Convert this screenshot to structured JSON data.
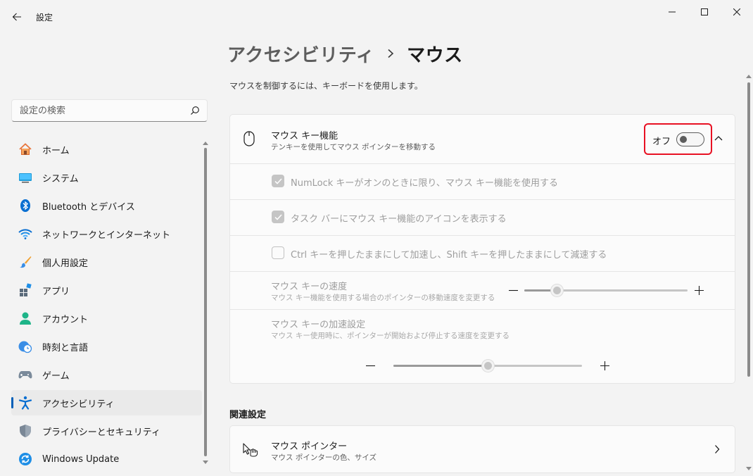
{
  "window": {
    "title": "設定"
  },
  "search": {
    "placeholder": "設定の検索"
  },
  "nav": {
    "items": [
      {
        "label": "ホーム",
        "icon": "home-icon"
      },
      {
        "label": "システム",
        "icon": "monitor-icon"
      },
      {
        "label": "Bluetooth とデバイス",
        "icon": "bluetooth-icon"
      },
      {
        "label": "ネットワークとインターネット",
        "icon": "wifi-icon"
      },
      {
        "label": "個人用設定",
        "icon": "brush-icon"
      },
      {
        "label": "アプリ",
        "icon": "apps-icon"
      },
      {
        "label": "アカウント",
        "icon": "person-icon"
      },
      {
        "label": "時刻と言語",
        "icon": "clock-globe-icon"
      },
      {
        "label": "ゲーム",
        "icon": "gamepad-icon"
      },
      {
        "label": "アクセシビリティ",
        "icon": "accessibility-icon"
      },
      {
        "label": "プライバシーとセキュリティ",
        "icon": "shield-icon"
      },
      {
        "label": "Windows Update",
        "icon": "update-icon"
      }
    ],
    "selected_index": 9
  },
  "breadcrumb": {
    "parent": "アクセシビリティ",
    "current": "マウス"
  },
  "description": "マウスを制御するには、キーボードを使用します。",
  "mouse_keys": {
    "title": "マウス キー機能",
    "subtitle": "テンキーを使用してマウス ポインターを移動する",
    "toggle_label": "オフ",
    "toggle_on": false,
    "options": [
      {
        "label": "NumLock キーがオンのときに限り、マウス キー機能を使用する",
        "checked": true
      },
      {
        "label": "タスク バーにマウス キー機能のアイコンを表示する",
        "checked": true
      },
      {
        "label": "Ctrl キーを押したままにして加速し、Shift キーを押したままにして減速する",
        "checked": false
      }
    ],
    "speed": {
      "title": "マウス キーの速度",
      "subtitle": "マウス キー機能を使用する場合のポインターの移動速度を変更する",
      "value_fraction": 0.2
    },
    "acceleration": {
      "title": "マウス キーの加速設定",
      "subtitle": "マウス キー使用時に、ポインターが開始および停止する速度を変更する",
      "value_fraction": 0.5
    }
  },
  "related": {
    "heading": "関連設定",
    "pointer": {
      "title": "マウス ポインター",
      "subtitle": "マウス ポインターの色、サイズ"
    }
  },
  "colors": {
    "accent": "#005fb8",
    "highlight_border": "#e81123"
  }
}
